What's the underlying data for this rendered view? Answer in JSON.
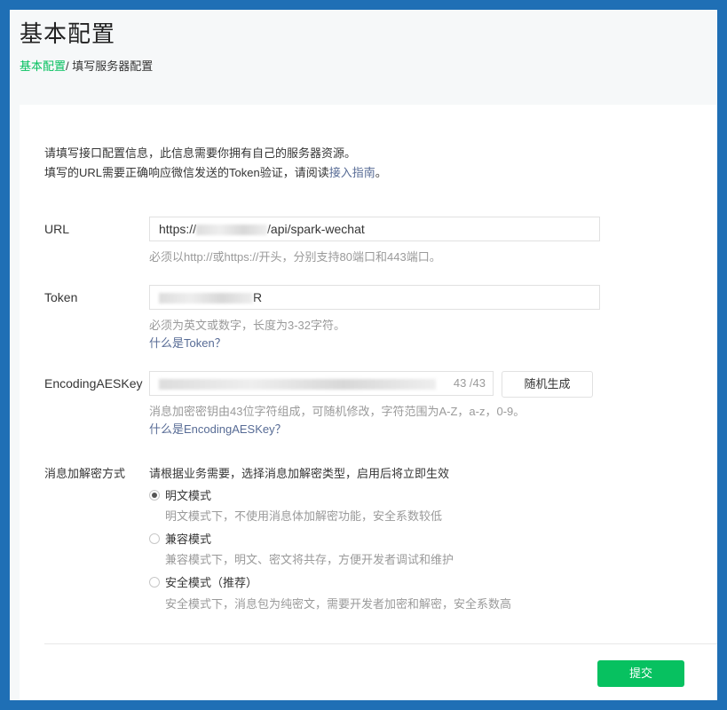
{
  "header": {
    "title": "基本配置",
    "breadcrumb_link": "基本配置",
    "breadcrumb_current": "/ 填写服务器配置"
  },
  "intro": {
    "line1": "请填写接口配置信息，此信息需要你拥有自己的服务器资源。",
    "line2_prefix": "填写的URL需要正确响应微信发送的Token验证，请阅读",
    "line2_link": "接入指南",
    "line2_suffix": "。"
  },
  "url": {
    "label": "URL",
    "value_prefix": "https://",
    "value_suffix": "/api/spark-wechat",
    "hint": "必须以http://或https://开头，分别支持80端口和443端口。"
  },
  "token": {
    "label": "Token",
    "value_tail": "R",
    "hint": "必须为英文或数字，长度为3-32字符。",
    "help": "什么是Token？"
  },
  "aes": {
    "label": "EncodingAESKey",
    "counter": "43 /43",
    "random_button": "随机生成",
    "hint": "消息加密密钥由43位字符组成，可随机修改，字符范围为A-Z，a-z，0-9。",
    "help": "什么是EncodingAESKey？"
  },
  "encryption": {
    "label": "消息加解密方式",
    "intro": "请根据业务需要，选择消息加解密类型，启用后将立即生效",
    "options": [
      {
        "label": "明文模式",
        "desc": "明文模式下，不使用消息体加解密功能，安全系数较低",
        "checked": true
      },
      {
        "label": "兼容模式",
        "desc": "兼容模式下，明文、密文将共存，方便开发者调试和维护",
        "checked": false
      },
      {
        "label": "安全模式（推荐）",
        "desc": "安全模式下，消息包为纯密文，需要开发者加密和解密，安全系数高",
        "checked": false
      }
    ]
  },
  "submit_label": "提交",
  "colors": {
    "accent": "#07c160",
    "link": "#576b95",
    "frame": "#1f6fb5"
  }
}
